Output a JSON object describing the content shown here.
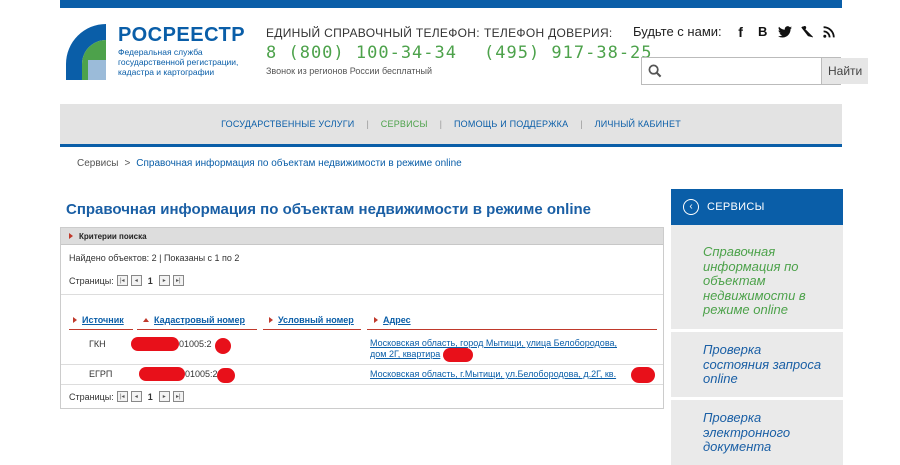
{
  "brand": {
    "name": "РОСРЕЕСТР",
    "subtitle": "Федеральная служба государственной регистрации, кадастра и картографии",
    "colors": {
      "primary": "#0a5ea8",
      "accent": "#4da24b"
    }
  },
  "phones": [
    {
      "label": "ЕДИНЫЙ СПРАВОЧНЫЙ ТЕЛЕФОН:",
      "number": "8 (800) 100-34-34",
      "note": "Звонок из регионов России бесплатный"
    },
    {
      "label": "ТЕЛЕФОН ДОВЕРИЯ:",
      "number": "(495) 917-38-25"
    }
  ],
  "social": {
    "label": "Будьте с нами:",
    "icons": [
      "facebook-icon",
      "vk-icon",
      "twitter-icon",
      "livejournal-icon",
      "rss-icon"
    ]
  },
  "search": {
    "value": "",
    "placeholder": "",
    "button_label": "Найти"
  },
  "nav": [
    {
      "label": "ГОСУДАРСТВЕННЫЕ УСЛУГИ",
      "active": false
    },
    {
      "label": "СЕРВИСЫ",
      "active": true
    },
    {
      "label": "ПОМОЩЬ И ПОДДЕРЖКА",
      "active": false
    },
    {
      "label": "ЛИЧНЫЙ КАБИНЕТ",
      "active": false
    }
  ],
  "breadcrumb": {
    "root": "Сервисы",
    "sep": ">",
    "current": "Справочная информация по объектам недвижимости в режиме online"
  },
  "page_title": "Справочная информация по объектам недвижимости в режиме online",
  "results": {
    "criteria_label": "Критерии поиска",
    "found_text": "Найдено объектов: 2 | Показаны с 1 по 2",
    "pages_label": "Страницы:",
    "current_page": "1",
    "columns": [
      "Источник",
      "Кадастровый номер",
      "Условный номер",
      "Адрес"
    ],
    "rows": [
      {
        "source": "ГКН",
        "cadastral": "01005:2",
        "conditional": "",
        "address_line1": "Московская область, город Мытищи, улица Белобородова,",
        "address_line2": "дом 2Г, квартира"
      },
      {
        "source": "ЕГРП",
        "cadastral": "01005:2",
        "conditional": "",
        "address_line1": "Московская область, г.Мытищи, ул.Белобородова, д.2Г, кв.",
        "address_line2": ""
      }
    ]
  },
  "sidebar": {
    "header": "СЕРВИСЫ",
    "items": [
      {
        "label": "Справочная информация по объектам недвижимости в режиме online",
        "active": true
      },
      {
        "label": "Проверка состояния запроса online",
        "active": false
      },
      {
        "label": "Проверка электронного документа",
        "active": false
      }
    ]
  }
}
